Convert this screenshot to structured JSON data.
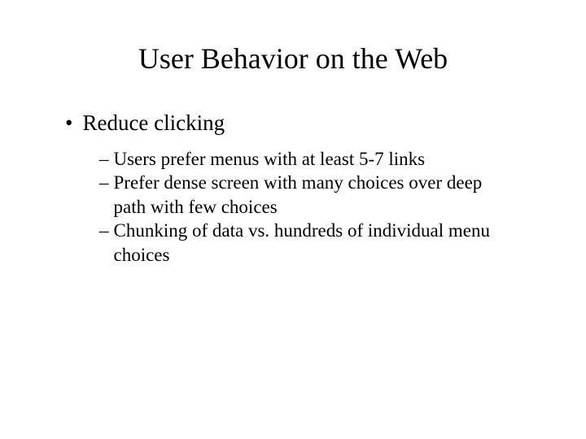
{
  "slide": {
    "title": "User Behavior on the Web",
    "bullet1": "Reduce clicking",
    "dash1": "Users prefer menus with at least 5-7 links",
    "dash2": "Prefer dense screen with many choices over deep path with few choices",
    "dash3": "Chunking of data vs. hundreds of individual menu choices"
  }
}
